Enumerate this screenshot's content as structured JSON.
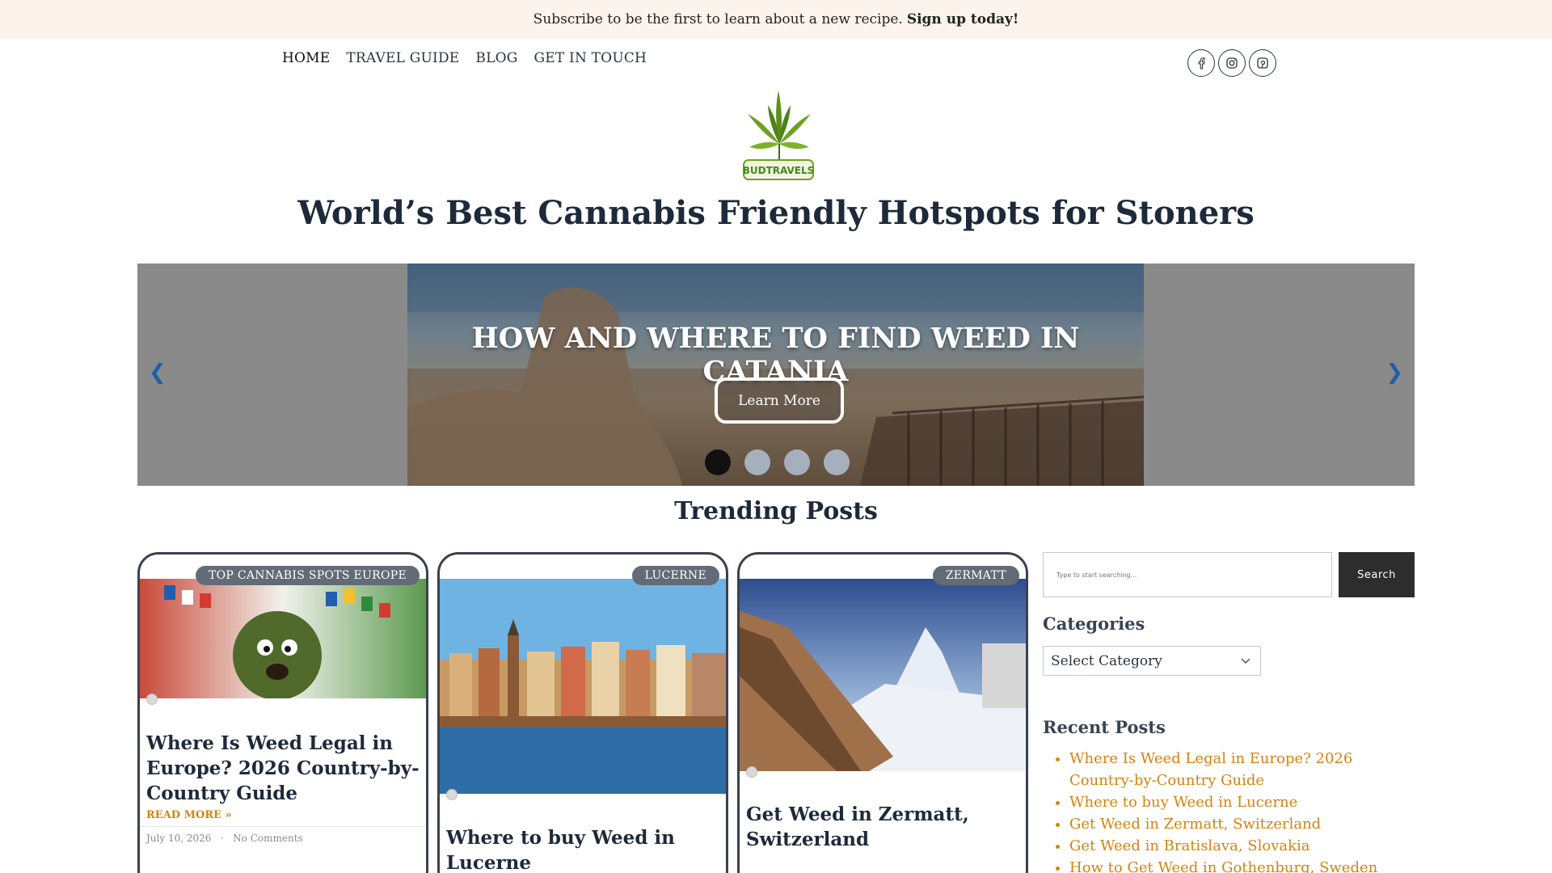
{
  "announcement": {
    "text": "Subscribe to be the first to learn about a new recipe.",
    "link": "Sign up today!"
  },
  "nav": {
    "items": [
      "HOME",
      "TRAVEL GUIDE",
      "BLOG",
      "GET IN TOUCH"
    ]
  },
  "social": {
    "icons": [
      "facebook-icon",
      "instagram-icon",
      "pinterest-icon"
    ]
  },
  "logo": {
    "text": "BUDTRAVELS"
  },
  "site_title": "World’s Best Cannabis Friendly Hotspots for Stoners",
  "slider": {
    "title": "HOW AND WHERE TO FIND WEED IN CATANIA",
    "button": "Learn More",
    "slide_count": 4,
    "active_index": 0
  },
  "trending": {
    "heading": "Trending Posts"
  },
  "cards": [
    {
      "badge": "TOP CANNABIS SPOTS EUROPE",
      "title": "Where Is Weed Legal in Europe? 2026 Country-by-Country Guide",
      "read_more": "READ MORE »",
      "date": "July 10, 2026",
      "separator": "·",
      "comments": "No Comments"
    },
    {
      "badge": "LUCERNE",
      "title": "Where to buy Weed in Lucerne"
    },
    {
      "badge": "ZERMATT",
      "title": "Get Weed in Zermatt, Switzerland"
    }
  ],
  "sidebar": {
    "search_placeholder": "Type to start searching...",
    "search_button": "Search",
    "categories_title": "Categories",
    "category_selected": "Select Category",
    "recent_title": "Recent Posts",
    "recent_posts": [
      "Where Is Weed Legal in Europe? 2026 Country-by-Country Guide",
      "Where to buy Weed in Lucerne",
      "Get Weed in Zermatt, Switzerland",
      "Get Weed in Bratislava, Slovakia",
      "How to Get Weed in Gothenburg, Sweden"
    ]
  },
  "colors": {
    "accent": "#d3830f",
    "text": "#1e2a3a",
    "topbar": "#fcf4ec",
    "slider_dot_active": "#111111"
  }
}
